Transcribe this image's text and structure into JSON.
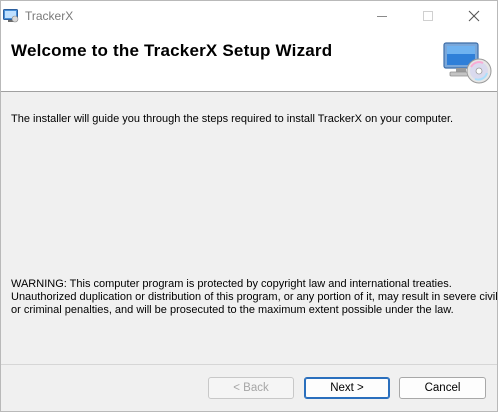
{
  "window": {
    "title": "TrackerX"
  },
  "header": {
    "title": "Welcome to the TrackerX Setup Wizard",
    "icon": "computer-cd-icon"
  },
  "body": {
    "intro": "The installer will guide you through the steps required to install TrackerX on your computer.",
    "warning_lines": [
      "WARNING: This computer program is protected by copyright law and international treaties.",
      "Unauthorized duplication or distribution of this program, or any portion of it, may result in severe civil",
      "or criminal penalties, and will be prosecuted to the maximum extent possible under the law."
    ]
  },
  "buttons": {
    "back": "< Back",
    "next": "Next >",
    "cancel": "Cancel"
  },
  "colors": {
    "accent": "#2a6fbd",
    "dialog_bg": "#f0f0f0",
    "disabled_text": "#a6a6a6"
  }
}
